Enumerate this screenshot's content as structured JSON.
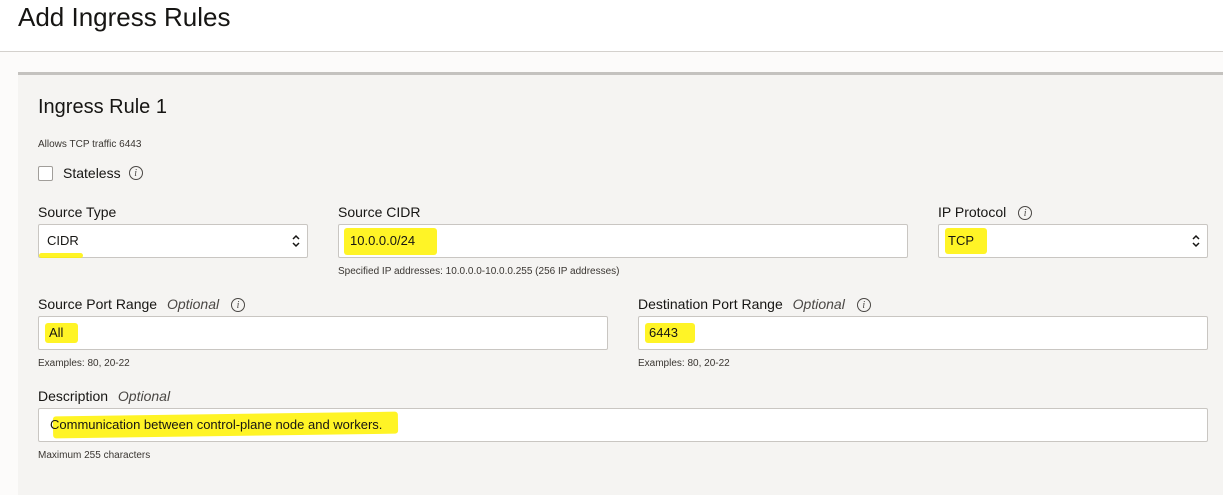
{
  "page": {
    "title": "Add Ingress Rules"
  },
  "rule": {
    "title": "Ingress Rule 1",
    "caption": "Allows TCP traffic 6443",
    "stateless_label": "Stateless",
    "stateless_checked": false
  },
  "source_type": {
    "label": "Source Type",
    "value": "CIDR"
  },
  "source_cidr": {
    "label": "Source CIDR",
    "value": "10.0.0.0/24",
    "help": "Specified IP addresses: 10.0.0.0-10.0.0.255 (256 IP addresses)"
  },
  "ip_protocol": {
    "label": "IP Protocol",
    "value": "TCP"
  },
  "source_port": {
    "label": "Source Port Range",
    "optional": "Optional",
    "value": "All",
    "help": "Examples: 80, 20-22"
  },
  "dest_port": {
    "label": "Destination Port Range",
    "optional": "Optional",
    "value": "6443",
    "help": "Examples: 80, 20-22"
  },
  "description": {
    "label": "Description",
    "optional": "Optional",
    "value": "Communication between control-plane node and workers.",
    "help": "Maximum 255 characters"
  },
  "icons": {
    "info": "i"
  },
  "colors": {
    "highlight": "#fff200"
  }
}
